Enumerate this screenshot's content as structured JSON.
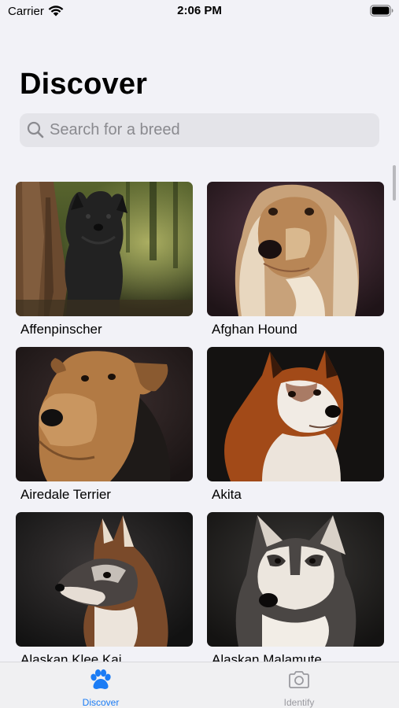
{
  "status_bar": {
    "carrier": "Carrier",
    "time": "2:06 PM",
    "wifi_icon": "wifi-icon",
    "battery_icon": "battery-full-icon"
  },
  "header": {
    "title": "Discover"
  },
  "search": {
    "placeholder": "Search for a breed",
    "value": "",
    "icon": "magnifying-glass-icon"
  },
  "breeds": [
    {
      "name": "Affenpinscher"
    },
    {
      "name": "Afghan Hound"
    },
    {
      "name": "Airedale Terrier"
    },
    {
      "name": "Akita"
    },
    {
      "name": "Alaskan Klee Kai"
    },
    {
      "name": "Alaskan Malamute"
    }
  ],
  "tab_bar": {
    "tabs": [
      {
        "label": "Discover",
        "icon": "paw-icon",
        "selected": true
      },
      {
        "label": "Identify",
        "icon": "camera-icon",
        "selected": false
      }
    ]
  },
  "colors": {
    "accent": "#1b7cf5",
    "background": "#f2f2f7",
    "search_field": "#e4e4e9",
    "tab_inactive": "#9a9aa0"
  }
}
